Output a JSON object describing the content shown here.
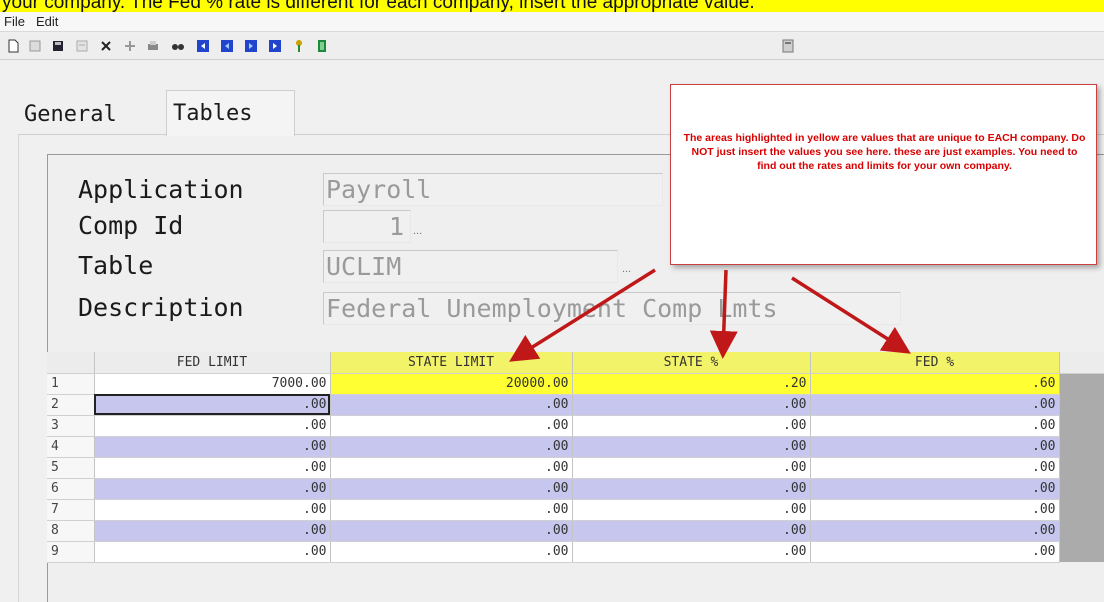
{
  "instruction": "your company.   The Fed % rate is different for each company, insert the appropriate value.",
  "menu": {
    "file": "File",
    "edit": "Edit"
  },
  "toolbar": {
    "icons": [
      "new-document-icon",
      "print-preview-icon",
      "save-icon",
      "form-icon",
      "delete-icon",
      "add-row-icon",
      "print-icon",
      "find-icon",
      "first-record-icon",
      "previous-record-icon",
      "next-record-icon",
      "last-record-icon",
      "key-icon",
      "exit-icon",
      "calculator-icon"
    ]
  },
  "tabs": {
    "general": "General",
    "tables": "Tables"
  },
  "form": {
    "application_label": "Application",
    "application_value": "Payroll",
    "comp_id_label": "Comp Id",
    "comp_id_value": "1",
    "table_label": "Table",
    "table_value": "UCLIM",
    "description_label": "Description",
    "description_value": "Federal Unemployment Comp Lmts",
    "ellipsis": "..."
  },
  "callout": {
    "text": "The areas highlighted in yellow are values that are unique to EACH company.  Do NOT just insert the values you see here.  these are just examples.  You need to find out the rates and limits for your own company."
  },
  "grid": {
    "columns": [
      "FED LIMIT",
      "STATE LIMIT",
      "STATE %",
      "FED %"
    ],
    "rows": [
      {
        "n": "1",
        "cells": [
          "7000.00",
          "20000.00",
          ".20",
          ".60"
        ]
      },
      {
        "n": "2",
        "cells": [
          ".00",
          ".00",
          ".00",
          ".00"
        ]
      },
      {
        "n": "3",
        "cells": [
          ".00",
          ".00",
          ".00",
          ".00"
        ]
      },
      {
        "n": "4",
        "cells": [
          ".00",
          ".00",
          ".00",
          ".00"
        ]
      },
      {
        "n": "5",
        "cells": [
          ".00",
          ".00",
          ".00",
          ".00"
        ]
      },
      {
        "n": "6",
        "cells": [
          ".00",
          ".00",
          ".00",
          ".00"
        ]
      },
      {
        "n": "7",
        "cells": [
          ".00",
          ".00",
          ".00",
          ".00"
        ]
      },
      {
        "n": "8",
        "cells": [
          ".00",
          ".00",
          ".00",
          ".00"
        ]
      },
      {
        "n": "9",
        "cells": [
          ".00",
          ".00",
          ".00",
          ".00"
        ]
      }
    ]
  },
  "colors": {
    "highlight": "#ffff33",
    "alt_row": "#c6c6ee",
    "callout_text": "#d80000",
    "arrow": "#c01818"
  }
}
